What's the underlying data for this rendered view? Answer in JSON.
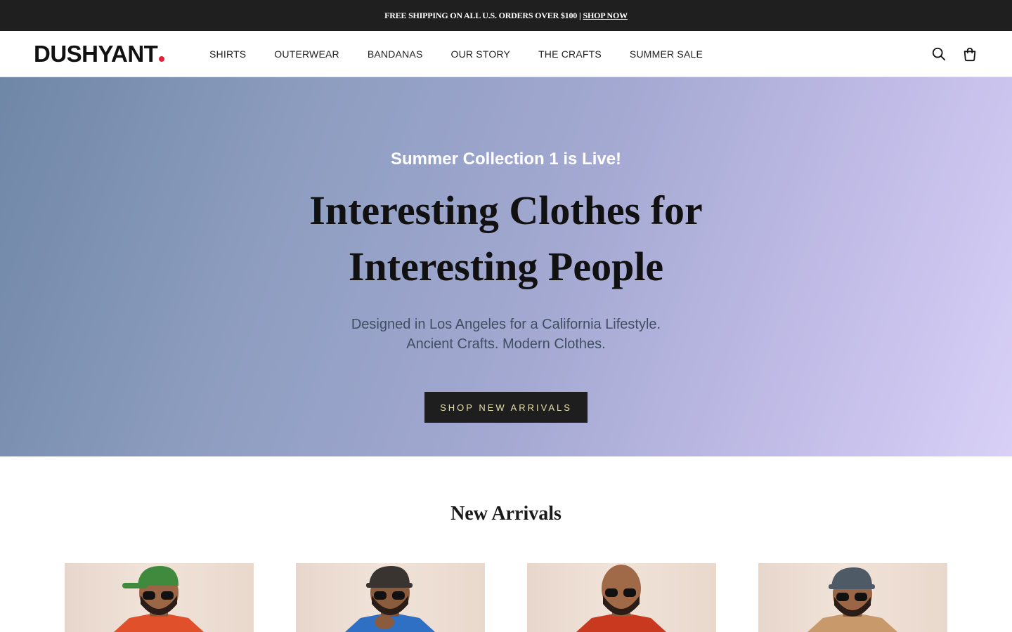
{
  "announcement": {
    "text": "FREE SHIPPING ON ALL U.S. ORDERS OVER $100",
    "separator": "|",
    "link": "SHOP NOW"
  },
  "header": {
    "logo": "DUSHYANT",
    "nav": [
      "SHIRTS",
      "OUTERWEAR",
      "BANDANAS",
      "OUR STORY",
      "THE CRAFTS",
      "SUMMER SALE"
    ],
    "icons": [
      "search-icon",
      "shopping-bag-icon"
    ]
  },
  "hero": {
    "kicker": "Summer Collection 1 is Live!",
    "title": "Interesting Clothes for Interesting People",
    "subtitle_line1": "Designed in Los Angeles for a California Lifestyle.",
    "subtitle_line2": "Ancient Crafts. Modern Clothes.",
    "cta": "SHOP NEW ARRIVALS",
    "gradient_colors": [
      "#6f87a6",
      "#a4a9d2",
      "#d8d0f6"
    ]
  },
  "new_arrivals": {
    "title": "New Arrivals",
    "products": [
      {
        "cap_color": "#3f8a3c",
        "shirt_color": "#e0502a"
      },
      {
        "cap_color": "#3a3431",
        "shirt_color": "#2f6fc4"
      },
      {
        "cap_color": "none",
        "shirt_color": "#c8391f"
      },
      {
        "cap_color": "#4e5a66",
        "shirt_color": "#c89a6b"
      }
    ]
  },
  "colors": {
    "announcement_bg": "#1f1f1f",
    "logo_dot": "#e0243a",
    "cta_bg": "#1e1e1e",
    "cta_text": "#e6dfae"
  }
}
